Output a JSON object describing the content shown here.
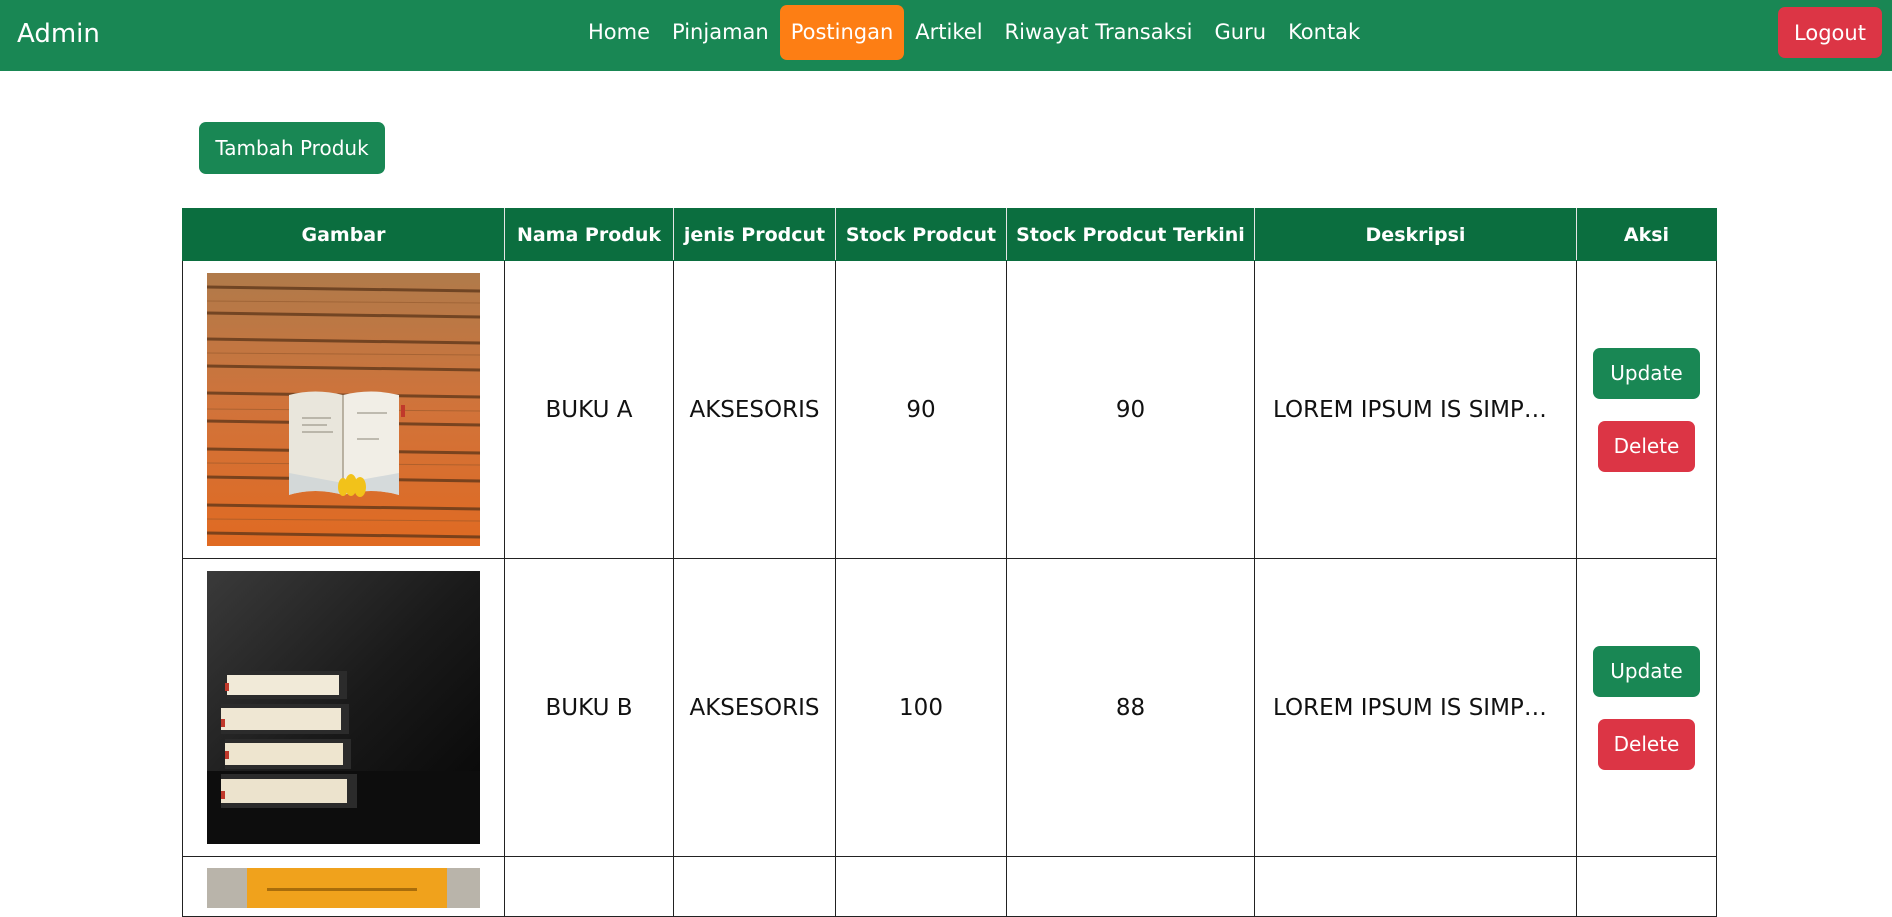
{
  "navbar": {
    "brand": "Admin",
    "items": [
      {
        "label": "Home"
      },
      {
        "label": "Pinjaman"
      },
      {
        "label": "Postingan",
        "active": true
      },
      {
        "label": "Artikel"
      },
      {
        "label": "Riwayat Transaksi"
      },
      {
        "label": "Guru"
      },
      {
        "label": "Kontak"
      }
    ],
    "logout_label": "Logout"
  },
  "actions": {
    "add_label": "Tambah Produk"
  },
  "table": {
    "headers": [
      "Gambar",
      "Nama Produk",
      "jenis Prodcut",
      "Stock Prodcut",
      "Stock Prodcut Terkini",
      "Deskripsi",
      "Aksi"
    ],
    "rows": [
      {
        "image": "open-book-on-wooden-table",
        "name": "BUKU A",
        "type": "AKSESORIS",
        "stock": "90",
        "stock_current": "90",
        "description": "LOREM IPSUM IS SIMPL...",
        "update_label": "Update",
        "delete_label": "Delete"
      },
      {
        "image": "stack-of-books-dark-background",
        "name": "BUKU B",
        "type": "AKSESORIS",
        "stock": "100",
        "stock_current": "88",
        "description": "LOREM IPSUM IS SIMPL...",
        "update_label": "Update",
        "delete_label": "Delete"
      },
      {
        "image": "zero-to-one-book-cover"
      }
    ]
  },
  "colors": {
    "navbar": "#198754",
    "active_nav": "#fd7e14",
    "danger": "#dc3545",
    "table_header": "#0b6e3f"
  }
}
